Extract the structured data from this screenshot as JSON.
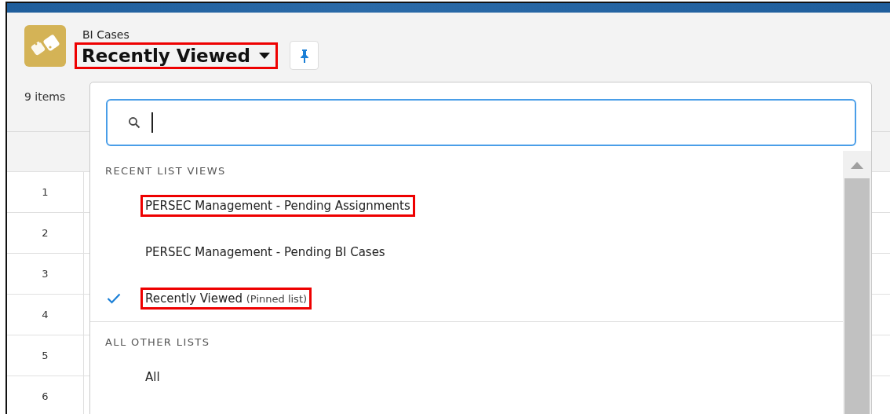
{
  "header": {
    "object_label": "BI Cases",
    "list_title": "Recently Viewed",
    "title_highlighted": true,
    "item_count": "9 items"
  },
  "table": {
    "rows": [
      "1",
      "2",
      "3",
      "4",
      "5",
      "6"
    ]
  },
  "list_picker": {
    "sections": [
      {
        "heading": "RECENT LIST VIEWS",
        "items": [
          {
            "label": "PERSEC Management - Pending Assignments",
            "selected": false,
            "highlighted": true
          },
          {
            "label": "PERSEC Management - Pending BI Cases",
            "selected": false,
            "highlighted": false
          },
          {
            "label": "Recently Viewed",
            "note": "(Pinned list)",
            "selected": true,
            "highlighted": true
          }
        ]
      },
      {
        "heading": "ALL OTHER LISTS",
        "items": [
          {
            "label": "All",
            "selected": false,
            "highlighted": false
          }
        ]
      }
    ]
  }
}
